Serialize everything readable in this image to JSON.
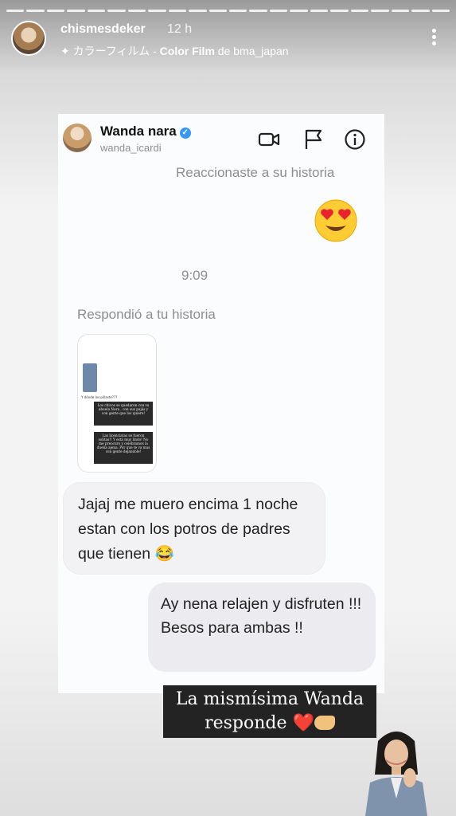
{
  "story": {
    "username": "chismesdeker",
    "time": "12 h",
    "music_prefix": "カラーフィルム - ",
    "music_title": "Color Film",
    "music_suffix": " de bma_japan"
  },
  "chat": {
    "name": "Wanda nara",
    "handle": "wanda_icardi",
    "reacted_label": "Reaccionaste a su historia",
    "reaction_emoji": "😍",
    "time": "9:09",
    "replied_label": "Respondió a tu historia",
    "thumb": {
      "question": "Y dónde los pillaste???",
      "box1": "Los chicos se quedaron con su abuela Nora , con sus pajás y con gente que los quiere!",
      "box2": "Las licenciatas se fueron solitas!! Y está muy lindo! No me preocuro y celebramos la dueña ajena. Por que te va mas con gente dejandole!"
    },
    "incoming": "Jajaj me muero encima 1 noche estan con los potros de padres que tienen 😂",
    "outgoing": "Ay nena relajen y disfruten !!! Besos para ambas !!"
  },
  "caption": {
    "line1": "La mismísima Wanda",
    "line2": "responde",
    "heart": "❤️"
  }
}
